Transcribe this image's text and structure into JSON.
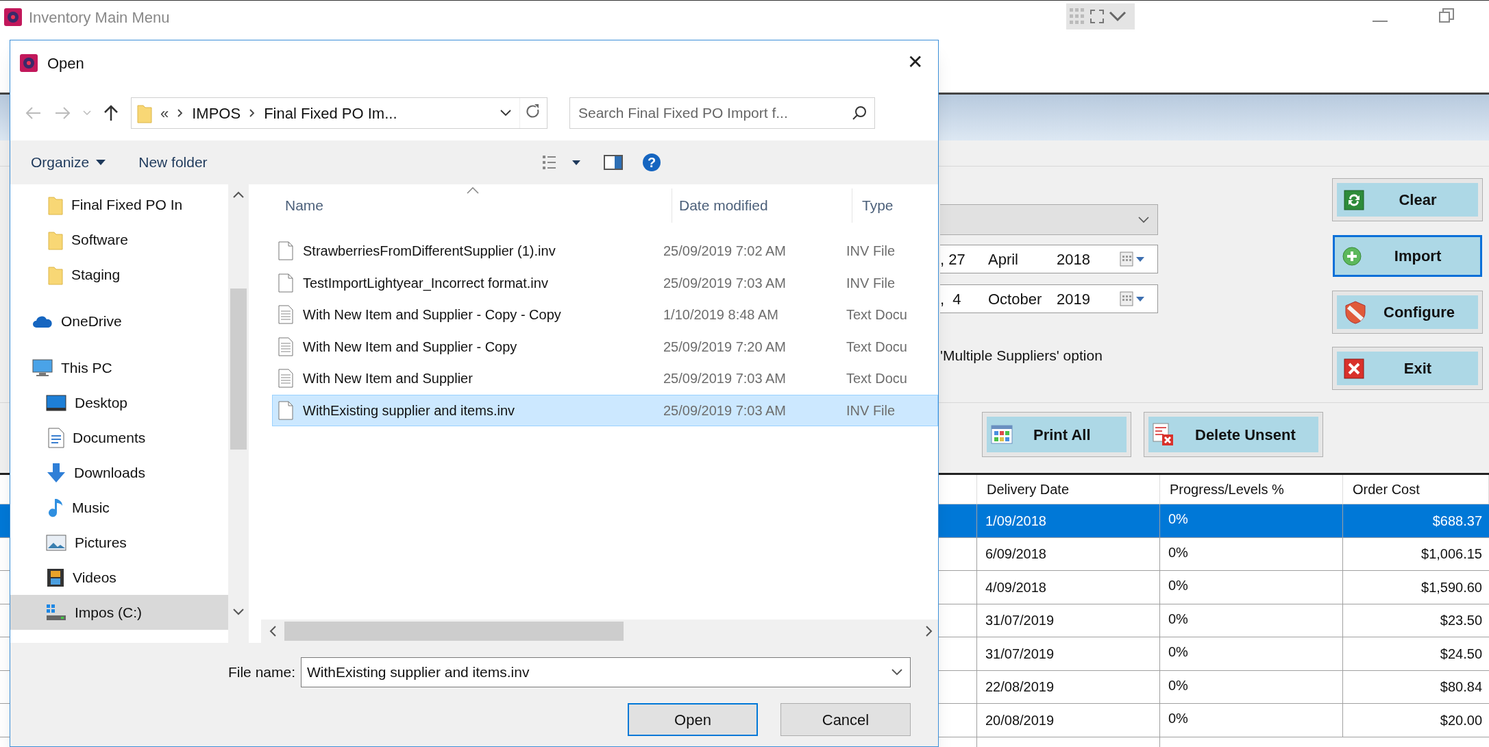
{
  "main_window": {
    "title": "Inventory Main Menu",
    "date_from": {
      "day": ", 27",
      "month": "April",
      "year": "2018"
    },
    "date_to": {
      "day": ",  4",
      "month": "October",
      "year": "2019"
    },
    "option_label": "'Multiple Suppliers' option",
    "side_buttons": [
      {
        "label": "Clear",
        "kind": "refresh",
        "focused": false
      },
      {
        "label": "Import",
        "kind": "add",
        "focused": true
      },
      {
        "label": "Configure",
        "kind": "shield",
        "focused": false
      },
      {
        "label": "Exit",
        "kind": "close",
        "focused": false
      }
    ],
    "action_buttons": [
      {
        "label": "Print All",
        "kind": "grid"
      },
      {
        "label": "Delete Unsent",
        "kind": "delete"
      }
    ],
    "table": {
      "columns": [
        "Delivery Date",
        "Progress/Levels %",
        "Order Cost"
      ],
      "rows": [
        {
          "delivery_date": "1/09/2018",
          "progress": "0%",
          "order_cost": "$688.37",
          "selected": true
        },
        {
          "delivery_date": "6/09/2018",
          "progress": "0%",
          "order_cost": "$1,006.15",
          "selected": false
        },
        {
          "delivery_date": "4/09/2018",
          "progress": "0%",
          "order_cost": "$1,590.60",
          "selected": false
        },
        {
          "delivery_date": "31/07/2019",
          "progress": "0%",
          "order_cost": "$23.50",
          "selected": false
        },
        {
          "delivery_date": "31/07/2019",
          "progress": "0%",
          "order_cost": "$24.50",
          "selected": false
        },
        {
          "delivery_date": "22/08/2019",
          "progress": "0%",
          "order_cost": "$80.84",
          "selected": false
        },
        {
          "delivery_date": "20/08/2019",
          "progress": "0%",
          "order_cost": "$20.00",
          "selected": false
        }
      ]
    }
  },
  "open_dialog": {
    "title": "Open",
    "close": "✕",
    "address": {
      "overflow": "«",
      "segments": [
        "IMPOS",
        "Final Fixed PO Im..."
      ]
    },
    "search": {
      "placeholder": "Search Final Fixed PO Import f..."
    },
    "toolbar": {
      "organize": "Organize",
      "new_folder": "New folder",
      "help": "?"
    },
    "nav_pane": [
      {
        "label": "Final Fixed PO In",
        "kind": "folder",
        "selected": false
      },
      {
        "label": "Software",
        "kind": "folder",
        "selected": false
      },
      {
        "label": "Staging",
        "kind": "folder",
        "selected": false
      },
      {
        "label": "OneDrive",
        "kind": "cloud",
        "selected": false
      },
      {
        "label": "This PC",
        "kind": "pc",
        "selected": false,
        "children": [
          {
            "label": "Desktop",
            "kind": "desktop",
            "selected": false
          },
          {
            "label": "Documents",
            "kind": "documents",
            "selected": false
          },
          {
            "label": "Downloads",
            "kind": "downloads",
            "selected": false
          },
          {
            "label": "Music",
            "kind": "music",
            "selected": false
          },
          {
            "label": "Pictures",
            "kind": "pictures",
            "selected": false
          },
          {
            "label": "Videos",
            "kind": "videos",
            "selected": false
          },
          {
            "label": "Impos (C:)",
            "kind": "drive",
            "selected": true
          }
        ]
      }
    ],
    "columns": [
      "Name",
      "Date modified",
      "Type"
    ],
    "files": [
      {
        "name": "StrawberriesFromDifferentSupplier (1).inv",
        "date": "25/09/2019 7:02 AM",
        "type": "INV File",
        "kind": "blank",
        "selected": false
      },
      {
        "name": "TestImportLightyear_Incorrect format.inv",
        "date": "25/09/2019 7:03 AM",
        "type": "INV File",
        "kind": "blank",
        "selected": false
      },
      {
        "name": "With New Item and Supplier - Copy - Copy",
        "date": "1/10/2019 8:48 AM",
        "type": "Text Docu",
        "kind": "text",
        "selected": false
      },
      {
        "name": "With New Item and Supplier - Copy",
        "date": "25/09/2019 7:20 AM",
        "type": "Text Docu",
        "kind": "text",
        "selected": false
      },
      {
        "name": "With New Item and Supplier",
        "date": "25/09/2019 7:03 AM",
        "type": "Text Docu",
        "kind": "text",
        "selected": false
      },
      {
        "name": "WithExisting supplier and items.inv",
        "date": "25/09/2019 7:03 AM",
        "type": "INV File",
        "kind": "blank",
        "selected": true
      }
    ],
    "file_name": {
      "label": "File name:",
      "value": "WithExisting supplier and items.inv"
    },
    "buttons": [
      {
        "label": "Open",
        "default": true
      },
      {
        "label": "Cancel",
        "default": false
      }
    ]
  }
}
